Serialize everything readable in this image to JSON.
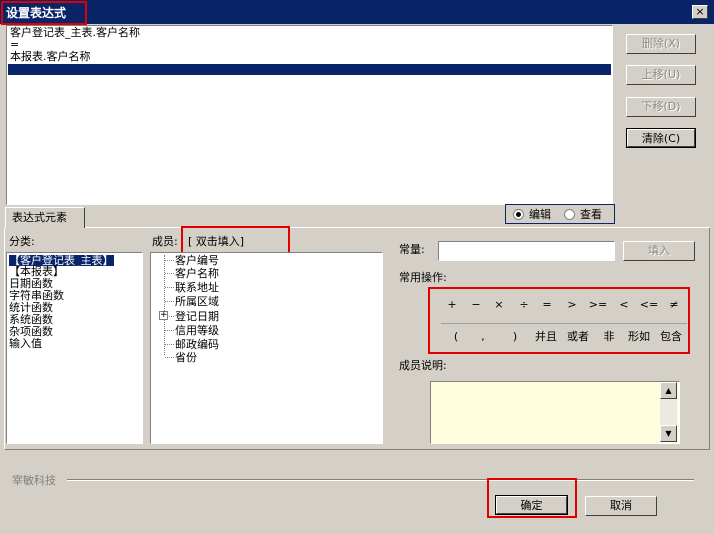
{
  "window": {
    "title": "设置表达式",
    "close_label": "×"
  },
  "expression": {
    "lines": [
      "客户登记表_主表.客户名称",
      "=",
      "本报表.客户名称",
      ""
    ]
  },
  "side_buttons": {
    "delete": "删除(X)",
    "move_up": "上移(U)",
    "move_down": "下移(D)",
    "clear": "清除(C)"
  },
  "tab": {
    "label": "表达式元素"
  },
  "mode": {
    "edit": "编辑",
    "view": "查看",
    "selected": "edit"
  },
  "category": {
    "label": "分类:",
    "items": [
      "【客户登记表_主表】",
      "【本报表】",
      "日期函数",
      "字符串函数",
      "统计函数",
      "系统函数",
      "杂项函数",
      "输入值"
    ]
  },
  "member": {
    "label": "成员:",
    "hint": "[ 双击填入]",
    "items": [
      "客户编号",
      "客户名称",
      "联系地址",
      "所属区域",
      "登记日期",
      "信用等级",
      "邮政编码",
      "省份"
    ]
  },
  "constant": {
    "label": "常量:",
    "value": "",
    "fill_button": "填入"
  },
  "common_ops": {
    "label": "常用操作:",
    "row1": [
      "+",
      "−",
      "×",
      "÷",
      "=",
      ">",
      ">=",
      "<",
      "<=",
      "≠"
    ],
    "row2": [
      "(",
      ",",
      ")",
      "并且",
      "或者",
      "非",
      "形如",
      "包含"
    ]
  },
  "member_desc": {
    "label": "成员说明:",
    "value": ""
  },
  "footer": {
    "brand": "宰敏科技",
    "ok": "确定",
    "cancel": "取消"
  },
  "colors": {
    "titlebar": "#0a246a",
    "highlight": "#e00000",
    "window": "#d4d0c8"
  }
}
